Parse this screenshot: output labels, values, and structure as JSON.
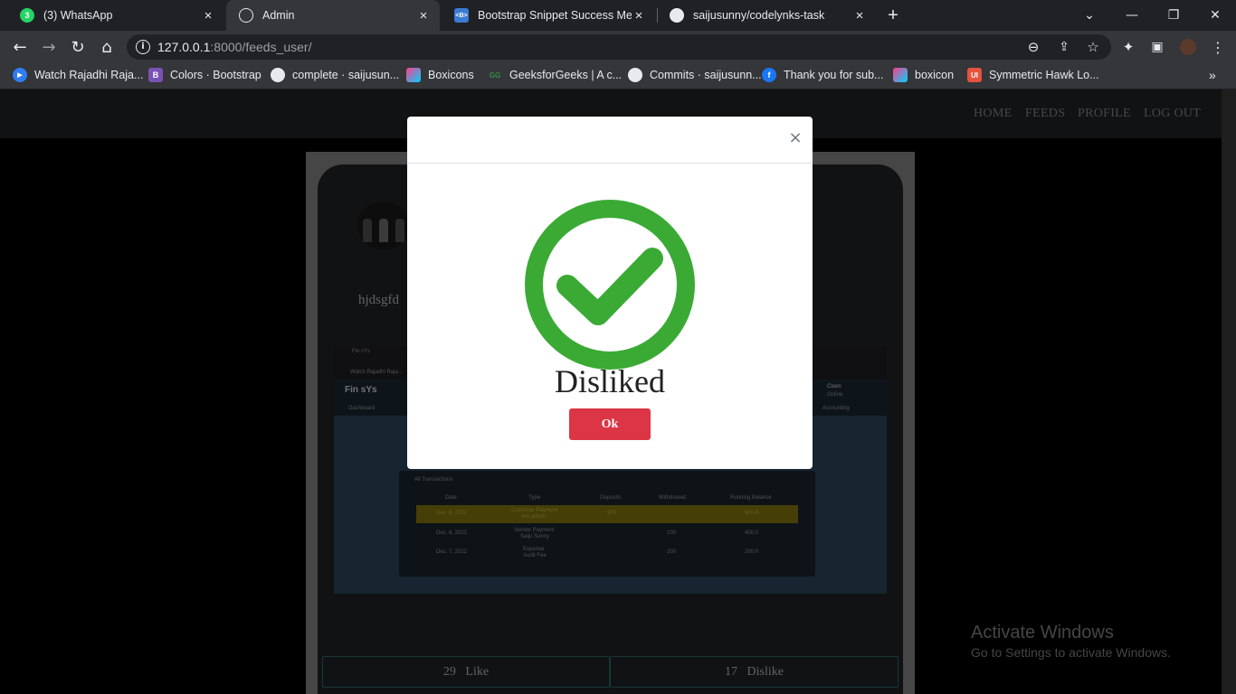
{
  "browser": {
    "tabs": [
      {
        "title": "(3) WhatsApp",
        "icon": "whatsapp-icon",
        "badge": "3"
      },
      {
        "title": "Admin",
        "icon": "globe-icon"
      },
      {
        "title": "Bootstrap Snippet Success Messa",
        "icon": "bootstrap-snippet-icon",
        "badge": "<B>"
      },
      {
        "title": "saijusunny/codelynks-task",
        "icon": "github-icon"
      }
    ],
    "url_host": "127.0.0.1",
    "url_rest": ":8000/feeds_user/",
    "bookmarks": [
      {
        "label": "Watch Rajadhi Raja...",
        "icon": "play-icon"
      },
      {
        "label": "Colors · Bootstrap",
        "icon": "bootstrap-icon",
        "badge": "B"
      },
      {
        "label": "complete · saijusun...",
        "icon": "github-icon"
      },
      {
        "label": "Boxicons",
        "icon": "boxicons-icon"
      },
      {
        "label": "GeeksforGeeks | A c...",
        "icon": "gfg-icon",
        "badge": "GG"
      },
      {
        "label": "Commits · saijusunn...",
        "icon": "github-icon"
      },
      {
        "label": "Thank you for sub...",
        "icon": "facebook-icon",
        "badge": "f"
      },
      {
        "label": "boxicon",
        "icon": "boxicons-icon"
      },
      {
        "label": "Symmetric Hawk Lo...",
        "icon": "ui-icon",
        "badge": "UI"
      }
    ]
  },
  "nav": {
    "home": "HOME",
    "feeds": "FEEDS",
    "profile": "PROFILE",
    "logout": "LOG OUT"
  },
  "post": {
    "text": "hjdsgfd",
    "screenshot": {
      "app_name": "Fin sYs",
      "tab_title": "Fin sYs",
      "bookmark": "Watch Rajadhi Raja...",
      "nav_dashboard": "Dashboard",
      "nav_accounting": "Accounting",
      "user_name": "Cloen",
      "user_status": "Online",
      "panel_title": "All Transactions",
      "headers": [
        "Date",
        "Type",
        "Deposits",
        "Withdrawal",
        "Running Balance"
      ],
      "rows": [
        {
          "date": "Dec. 6, 2022",
          "type": "Customer Payment",
          "type2": "Am admin",
          "deposits": "900",
          "withdrawal": "",
          "balance": "900.0"
        },
        {
          "date": "Dec. 6, 2022",
          "type": "Vendor Payment",
          "type2": "Saiju Sunny",
          "deposits": "",
          "withdrawal": "100",
          "balance": "400.0"
        },
        {
          "date": "Dec. 7, 2022",
          "type": "Expense",
          "type2": "Audit Fee",
          "deposits": "",
          "withdrawal": "200",
          "balance": "200.0"
        }
      ]
    },
    "like_count": "29",
    "like_label": "Like",
    "dislike_count": "17",
    "dislike_label": "Dislike"
  },
  "modal": {
    "message": "Disliked",
    "ok_label": "Ok",
    "close_glyph": "×"
  },
  "watermark": {
    "title": "Activate Windows",
    "subtitle": "Go to Settings to activate Windows."
  },
  "colors": {
    "success_green": "#3aaa35",
    "danger_red": "#dc3545"
  }
}
